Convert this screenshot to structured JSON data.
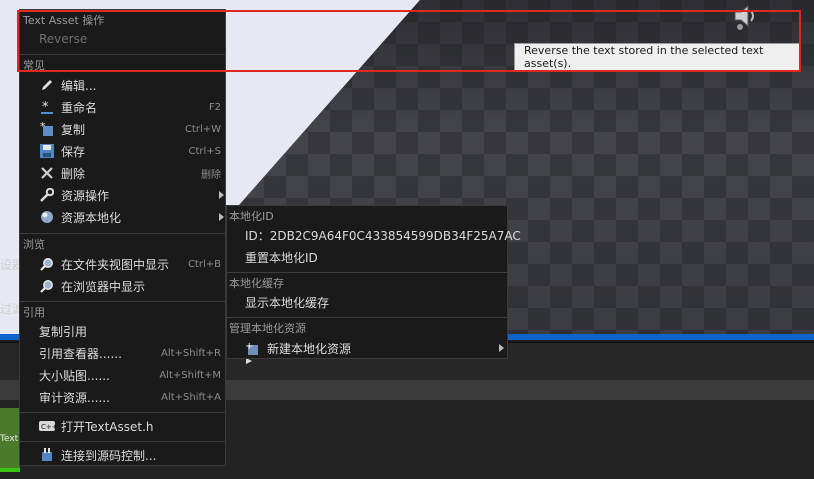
{
  "tooltip": {
    "text": "Reverse the text stored in the selected text asset(s)."
  },
  "background": {
    "left_clip_label": "设器",
    "left_clip_label2": "过滤",
    "asset_thumb_label": "Text Asset"
  },
  "menu": {
    "section_text_asset": "Text Asset 操作",
    "reverse_label": "Reverse",
    "section_common": "常见",
    "common_items": [
      {
        "label": "编辑...",
        "shortcut": "",
        "icon": "pencil-icon"
      },
      {
        "label": "重命名",
        "shortcut": "F2",
        "icon": "rename-asterisk-icon"
      },
      {
        "label": "复制",
        "shortcut": "Ctrl+W",
        "icon": "duplicate-icon"
      },
      {
        "label": "保存",
        "shortcut": "Ctrl+S",
        "icon": "save-floppy-icon"
      },
      {
        "label": "删除",
        "shortcut": "删除",
        "icon": "delete-x-icon"
      },
      {
        "label": "资源操作",
        "shortcut": "",
        "icon": "wrench-icon"
      },
      {
        "label": "资源本地化",
        "shortcut": "",
        "icon": "globe-icon"
      }
    ],
    "section_browse": "浏览",
    "browse_items": [
      {
        "label": "在文件夹视图中显示",
        "shortcut": "Ctrl+B",
        "icon": "magnifier-icon"
      },
      {
        "label": "在浏览器中显示",
        "shortcut": "",
        "icon": "magnifier-icon"
      }
    ],
    "section_reference": "引用",
    "reference_items": [
      {
        "label": "复制引用",
        "shortcut": ""
      },
      {
        "label": "引用查看器......",
        "shortcut": "Alt+Shift+R"
      },
      {
        "label": "大小贴图......",
        "shortcut": "Alt+Shift+M"
      },
      {
        "label": "审计资源......",
        "shortcut": "Alt+Shift+A"
      }
    ],
    "open_header_label": "打开TextAsset.h",
    "source_control_label": "连接到源码控制..."
  },
  "submenu": {
    "section_localization_id": "本地化ID",
    "id_label": "ID：2DB2C9A64F0C433854599DB34F25A7AC",
    "reset_id_label": "重置本地化ID",
    "section_cache": "本地化缓存",
    "show_cache_label": "显示本地化缓存",
    "section_manage": "管理本地化资源",
    "new_asset_label": "新建本地化资源"
  },
  "colors": {
    "highlight": "#e2271d",
    "accent_blue": "#0e63c8",
    "asset_green": "#39c414"
  }
}
